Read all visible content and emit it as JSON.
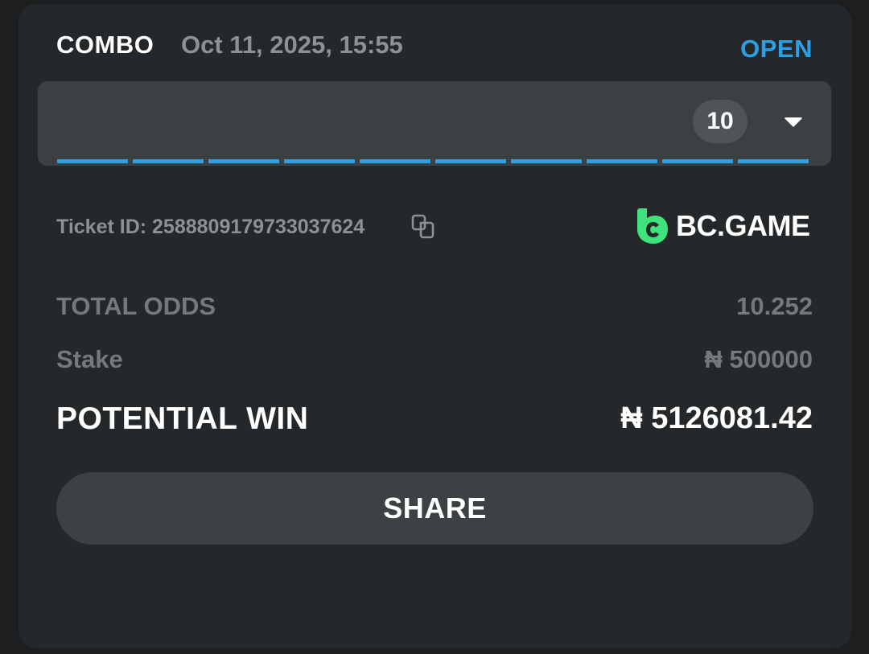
{
  "bet": {
    "type": "COMBO",
    "date": "Oct 11, 2025, 15:55",
    "status": "OPEN",
    "legs_count": "10",
    "legs_progress_segments": 10
  },
  "ticket": {
    "label": "Ticket ID: 2588809179733037624"
  },
  "brand": {
    "name": "BC.GAME",
    "accent_color": "#3ee37c"
  },
  "summary": {
    "total_odds_label": "TOTAL ODDS",
    "total_odds_value": "10.252",
    "stake_label": "Stake",
    "stake_value": "₦ 500000",
    "potential_win_label": "POTENTIAL WIN",
    "potential_win_value": "₦ 5126081.42"
  },
  "actions": {
    "share_label": "SHARE"
  },
  "colors": {
    "status_open": "#2f9fe4",
    "card_bg": "#25282a"
  },
  "icons": {
    "copy": "copy-icon",
    "dropdown": "chevron-down-icon",
    "logo": "bcgame-logo-icon"
  }
}
